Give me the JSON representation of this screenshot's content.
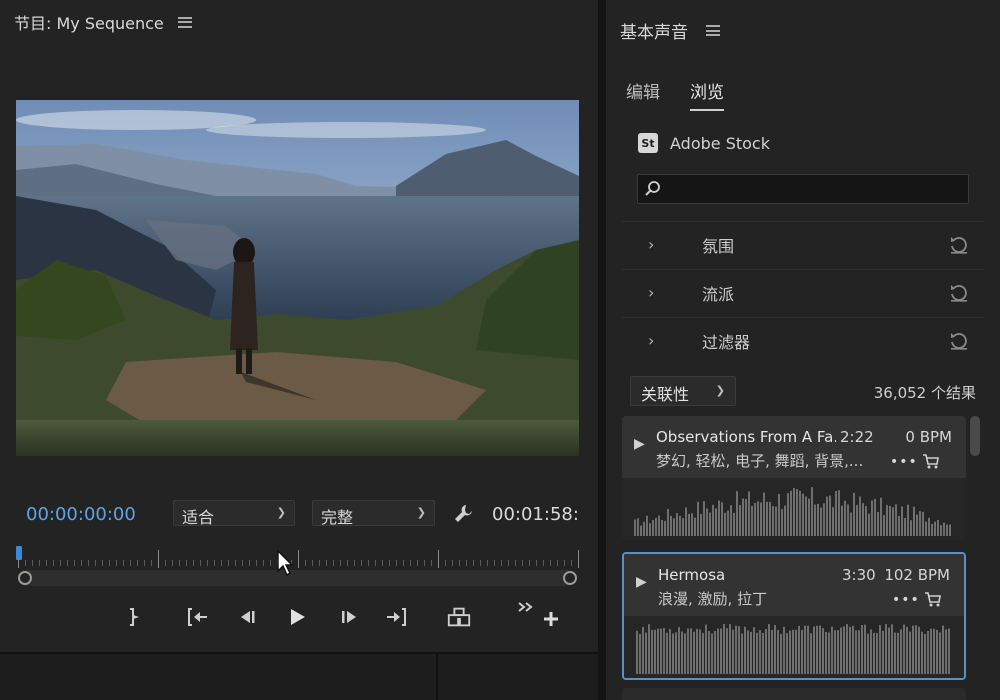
{
  "program": {
    "title": "节目: My Sequence",
    "timecode_current": "00:00:00:00",
    "fit_dropdown": "适合",
    "quality_dropdown": "完整",
    "timecode_duration": "00:01:58:"
  },
  "essential_sound": {
    "title": "基本声音",
    "tabs": [
      {
        "label": "编辑",
        "active": false
      },
      {
        "label": "浏览",
        "active": true
      }
    ],
    "stock_badge": "St",
    "stock_label": "Adobe Stock",
    "search_placeholder": "",
    "filters": [
      {
        "label": "氛围"
      },
      {
        "label": "流派"
      },
      {
        "label": "过滤器"
      }
    ],
    "sort_dropdown": "关联性",
    "results_count": "36,052 个结果",
    "results": [
      {
        "title": "Observations From A Fa...",
        "duration": "2:22",
        "bpm": "0 BPM",
        "tags": "梦幻, 轻松, 电子, 舞蹈, 背景,...",
        "more": "•••",
        "selected": false
      },
      {
        "title": "Hermosa",
        "duration": "3:30",
        "bpm": "102 BPM",
        "tags": "浪漫, 激励, 拉丁",
        "more": "•••",
        "selected": true
      }
    ]
  },
  "colors": {
    "accent_blue": "#5fa4e6",
    "selection_border": "#5a8fc7",
    "panel_bg": "#232323"
  }
}
